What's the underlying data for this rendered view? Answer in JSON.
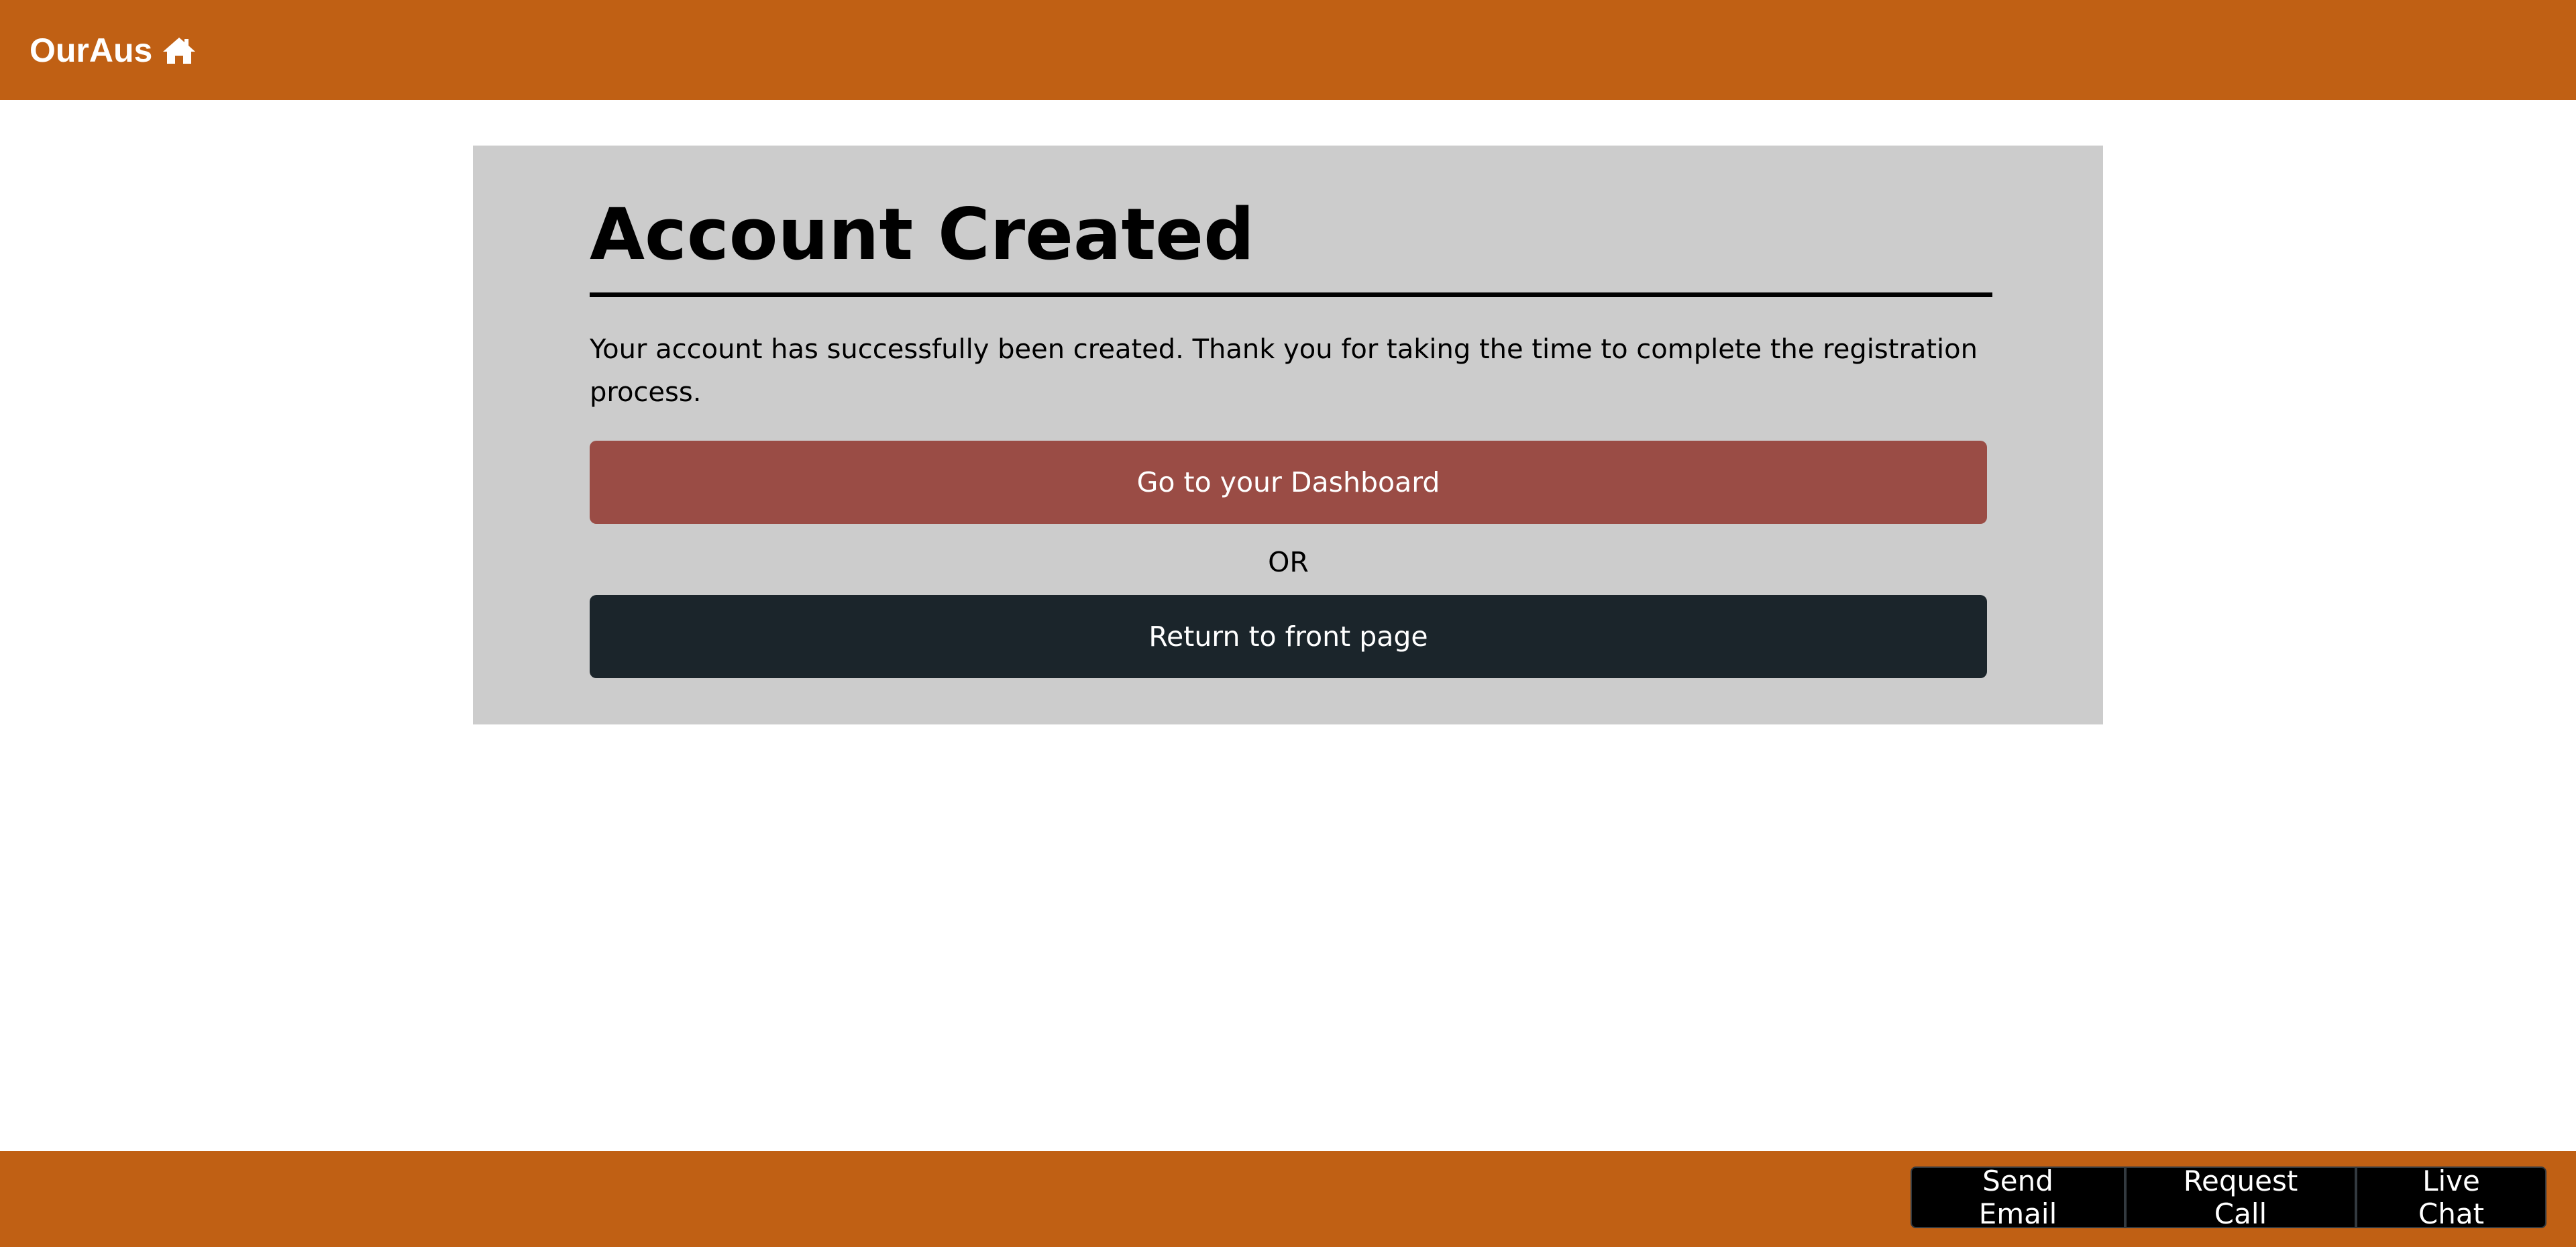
{
  "header": {
    "brand": "OurAus",
    "brand_icon": "home-icon"
  },
  "main": {
    "title": "Account Created",
    "message": "Your account has successfully been created. Thank you for taking the time to complete the registration process.",
    "dashboard_button": "Go to your Dashboard",
    "or_text": "OR",
    "front_page_button": "Return to front page"
  },
  "footer": {
    "send_email": "Send Email",
    "request_call": "Request Call",
    "live_chat": "Live Chat"
  },
  "colors": {
    "brand": "#c06014",
    "card": "#cccccc",
    "dashboard_button": "#9a4c45",
    "front_page_button": "#1b252b",
    "contact_button": "#000000"
  }
}
